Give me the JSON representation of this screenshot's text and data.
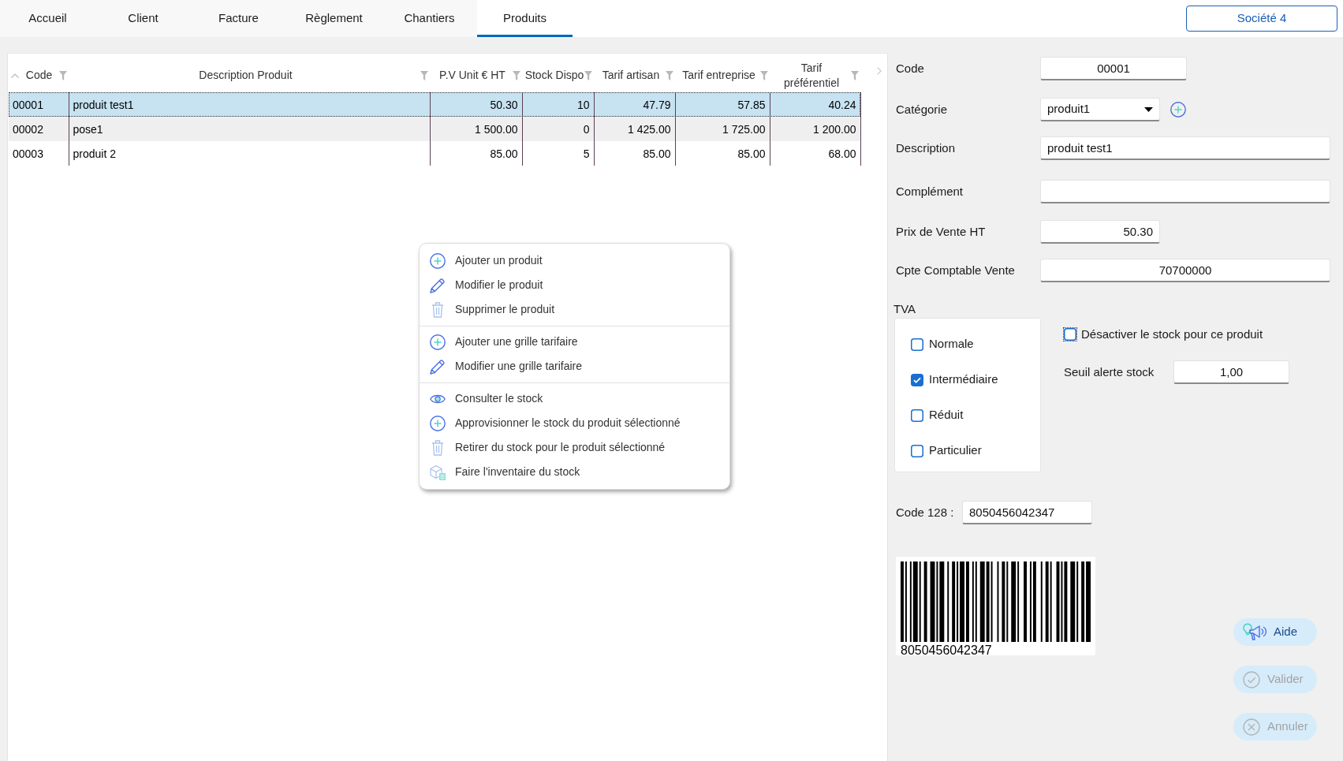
{
  "tabs": [
    {
      "label": "Accueil",
      "selected": false
    },
    {
      "label": "Client",
      "selected": false
    },
    {
      "label": "Facture",
      "selected": false
    },
    {
      "label": "Règlement",
      "selected": false
    },
    {
      "label": "Chantiers",
      "selected": false
    },
    {
      "label": "Produits",
      "selected": true
    }
  ],
  "company_button": {
    "label": "Société 4"
  },
  "product_table": {
    "columns": [
      {
        "label": "Code",
        "kind": "text",
        "sorted": true
      },
      {
        "label": "Description Produit",
        "kind": "text",
        "sorted": false
      },
      {
        "label": "P.V Unit € HT",
        "kind": "number",
        "sorted": false
      },
      {
        "label": "Stock Dispo",
        "kind": "number",
        "sorted": false
      },
      {
        "label": "Tarif artisan",
        "kind": "number",
        "sorted": false
      },
      {
        "label": "Tarif entreprise",
        "kind": "number",
        "sorted": false
      },
      {
        "label": "Tarif préférentiel",
        "kind": "number",
        "sorted": false
      }
    ],
    "rows": [
      {
        "selected": true,
        "cells": [
          "00001",
          "produit test1",
          "50.30",
          "10",
          "47.79",
          "57.85",
          "40.24"
        ]
      },
      {
        "selected": false,
        "cells": [
          "00002",
          "pose1",
          "1 500.00",
          "0",
          "1 425.00",
          "1 725.00",
          "1 200.00"
        ]
      },
      {
        "selected": false,
        "cells": [
          "00003",
          "produit 2",
          "85.00",
          "5",
          "85.00",
          "85.00",
          "68.00"
        ]
      }
    ]
  },
  "context_menu": {
    "groups": [
      {
        "items": [
          {
            "kind": "add",
            "label": "Ajouter un produit"
          },
          {
            "kind": "edit",
            "label": "Modifier le produit"
          },
          {
            "kind": "delete",
            "label": "Supprimer le produit"
          }
        ]
      },
      {
        "items": [
          {
            "kind": "add",
            "label": "Ajouter une grille tarifaire"
          },
          {
            "kind": "edit",
            "label": "Modifier une grille tarifaire"
          }
        ]
      },
      {
        "items": [
          {
            "kind": "view",
            "label": "Consulter le stock"
          },
          {
            "kind": "add",
            "label": "Approvisionner le stock du produit sélectionné"
          },
          {
            "kind": "delete",
            "label": "Retirer du stock pour le produit sélectionné"
          },
          {
            "kind": "inventory",
            "label": "Faire l'inventaire du stock"
          }
        ]
      }
    ]
  },
  "product_form": {
    "code": {
      "label": "Code",
      "value": "00001"
    },
    "category": {
      "label": "Catégorie",
      "value": "produit1"
    },
    "description": {
      "label": "Description",
      "value": "produit test1"
    },
    "complement": {
      "label": "Complément"
    },
    "sale_price": {
      "label": "Prix de Vente HT",
      "value": "50.30"
    },
    "sales_account": {
      "label": "Cpte Comptable Vente",
      "value": "70700000"
    },
    "vat": {
      "label": "TVA",
      "options": [
        {
          "label": "Normale",
          "checked": false
        },
        {
          "label": "Intermédiaire",
          "checked": true
        },
        {
          "label": "Réduit",
          "checked": false
        },
        {
          "label": "Particulier",
          "checked": false
        }
      ]
    },
    "disable_stock": {
      "label": "Désactiver le stock pour ce produit",
      "checked": false
    },
    "stock_alert": {
      "label": "Seuil alerte stock",
      "value": "1,00"
    },
    "code128": {
      "label": "Code 128 :",
      "value": "8050456042347"
    },
    "barcode": {
      "text": "8050456042347"
    }
  },
  "buttons": [
    {
      "kind": "help",
      "label": "Aide",
      "disabled": false
    },
    {
      "kind": "confirm",
      "label": "Valider",
      "disabled": true
    },
    {
      "kind": "cancel",
      "label": "Annuler",
      "disabled": true
    }
  ]
}
